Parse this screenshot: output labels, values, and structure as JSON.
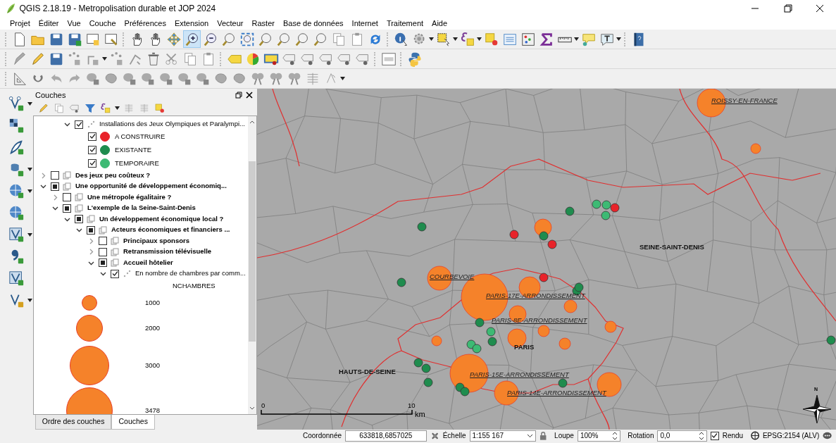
{
  "window": {
    "title": "QGIS 2.18.19 - Metropolisation durable et JOP 2024"
  },
  "menu": [
    "Projet",
    "Éditer",
    "Vue",
    "Couche",
    "Préférences",
    "Extension",
    "Vecteur",
    "Raster",
    "Base de données",
    "Internet",
    "Traitement",
    "Aide"
  ],
  "layers_panel": {
    "title": "Couches",
    "tree_continued": [
      {
        "kind": "layer",
        "label": "Installations des Jeux Olympiques et Paralympi...",
        "checked": true,
        "expanded": true,
        "children": [
          {
            "kind": "class",
            "label": "A CONSTRUIRE",
            "checked": true,
            "color": "#e8232a"
          },
          {
            "kind": "class",
            "label": "EXISTANTE",
            "checked": true,
            "color": "#1f8c4e"
          },
          {
            "kind": "class",
            "label": "TEMPORAIRE",
            "checked": true,
            "color": "#3dba74"
          }
        ]
      }
    ],
    "tree": [
      {
        "kind": "group",
        "label": "Des jeux peu coûteux ?",
        "checked": false,
        "partial": false,
        "expanded": false
      },
      {
        "kind": "group",
        "label": "Une opportunité de développement économiq...",
        "partial": true,
        "expanded": true,
        "children": [
          {
            "kind": "group",
            "label": "Une métropole égalitaire ?",
            "checked": false,
            "partial": false,
            "expanded": false
          },
          {
            "kind": "group",
            "label": "L'exemple de la Seine-Saint-Denis",
            "partial": true,
            "expanded": true,
            "children": [
              {
                "kind": "group",
                "label": "Un développement économique local ?",
                "partial": true,
                "expanded": true,
                "children": [
                  {
                    "kind": "group",
                    "label": "Acteurs économiques et financiers ...",
                    "partial": true,
                    "expanded": true,
                    "children": [
                      {
                        "kind": "group",
                        "label": "Principaux sponsors",
                        "checked": false,
                        "partial": false,
                        "expanded": false
                      },
                      {
                        "kind": "group",
                        "label": "Retransmission télévisuelle",
                        "checked": false,
                        "partial": false,
                        "expanded": false
                      },
                      {
                        "kind": "group",
                        "label": "Accueil hôtelier",
                        "partial": true,
                        "expanded": true,
                        "children": [
                          {
                            "kind": "layer",
                            "label": "En nombre de chambres par comm...",
                            "checked": true,
                            "expanded": true,
                            "children": [
                              {
                                "kind": "legend_title",
                                "label": "NCHAMBRES"
                              },
                              {
                                "kind": "size",
                                "label": "1000"
                              },
                              {
                                "kind": "size",
                                "label": "2000"
                              },
                              {
                                "kind": "size",
                                "label": "3000"
                              },
                              {
                                "kind": "size",
                                "label": "3478"
                              }
                            ]
                          }
                        ]
                      }
                    ]
                  }
                ]
              }
            ]
          }
        ]
      }
    ],
    "tabs": [
      {
        "label": "Ordre des couches",
        "selected": false
      },
      {
        "label": "Couches",
        "selected": true
      }
    ]
  },
  "map": {
    "labels": [
      {
        "kind": "commune",
        "text": "ROISSY-EN-FRANCE"
      },
      {
        "kind": "area",
        "text": "SEINE-SAINT-DENIS"
      },
      {
        "kind": "commune",
        "text": "COURBEVOIE"
      },
      {
        "kind": "commune",
        "text": "PARIS-17E-ARRONDISSEMENT"
      },
      {
        "kind": "commune",
        "text": "PARIS-8E-ARRONDISSEMENT"
      },
      {
        "kind": "area",
        "text": "PARIS"
      },
      {
        "kind": "area",
        "text": "HAUTS-DE-SEINE"
      },
      {
        "kind": "commune",
        "text": "PARIS-15E-ARRONDISSEMENT"
      },
      {
        "kind": "commune",
        "text": "PARIS-14E-ARRONDISSEMENT"
      }
    ],
    "scale_bar": {
      "start": "0",
      "end": "10",
      "unit": "km"
    },
    "north_label": "N"
  },
  "status_bar": {
    "coordinate_label": "Coordonnée",
    "coordinate": "633818,6857025",
    "scale_label": "Échelle",
    "scale": "1:155 167",
    "magnifier_label": "Loupe",
    "magnifier": "100%",
    "rotation_label": "Rotation",
    "rotation": "0,0",
    "render_label": "Rendu",
    "render_checked": true,
    "crs": "EPSG:2154 (ALV)"
  }
}
